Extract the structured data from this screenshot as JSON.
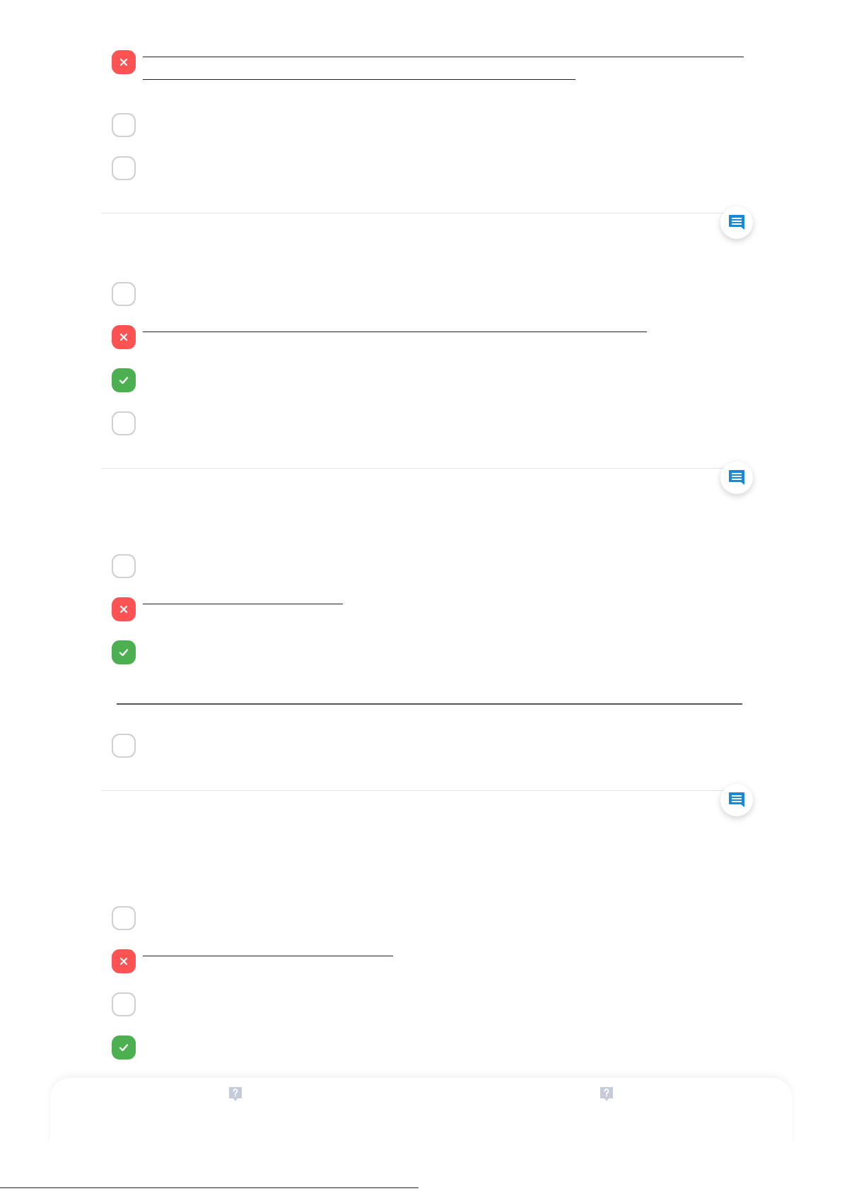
{
  "questions": [
    {
      "options": [
        {
          "kind": "wrong"
        },
        {
          "kind": "blank"
        },
        {
          "kind": "blank"
        }
      ]
    },
    {
      "has_comment": true,
      "options": [
        {
          "kind": "blank"
        },
        {
          "kind": "wrong"
        },
        {
          "kind": "correct"
        },
        {
          "kind": "blank"
        }
      ]
    },
    {
      "has_comment": true,
      "options": [
        {
          "kind": "blank"
        },
        {
          "kind": "wrong"
        },
        {
          "kind": "correct"
        },
        {
          "kind": "rule"
        },
        {
          "kind": "blank"
        }
      ]
    },
    {
      "has_comment": true,
      "options": [
        {
          "kind": "blank"
        },
        {
          "kind": "wrong"
        },
        {
          "kind": "blank"
        },
        {
          "kind": "correct"
        }
      ]
    }
  ],
  "bottom_bar": {
    "buttons": [
      {
        "kind": "help"
      },
      {
        "kind": "help"
      }
    ]
  }
}
